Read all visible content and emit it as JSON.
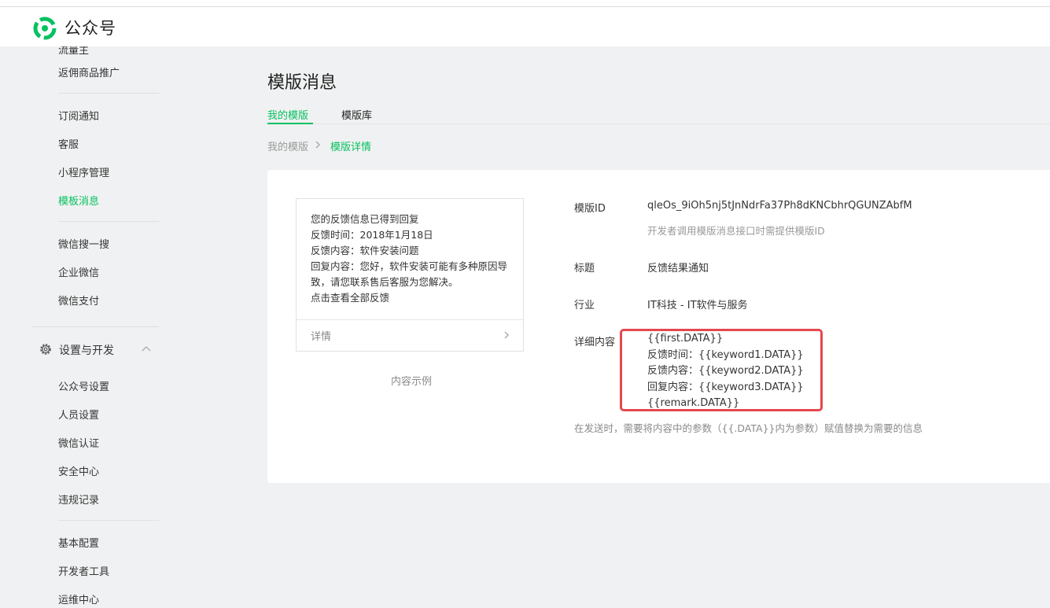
{
  "header": {
    "brand": "公众号",
    "brand_color": "#07c160"
  },
  "sidebar": {
    "cutoff_item": "流量主",
    "group1": [
      "返佣商品推广"
    ],
    "group2": [
      {
        "label": "订阅通知",
        "active": false
      },
      {
        "label": "客服",
        "active": false
      },
      {
        "label": "小程序管理",
        "active": false
      },
      {
        "label": "模板消息",
        "active": true
      }
    ],
    "group3": [
      "微信搜一搜",
      "企业微信",
      "微信支付"
    ],
    "section": {
      "label": "设置与开发",
      "icon": "gear-icon",
      "expanded": true
    },
    "group4": [
      "公众号设置",
      "人员设置",
      "微信认证",
      "安全中心",
      "违规记录"
    ],
    "group5": [
      "基本配置",
      "开发者工具",
      "运维中心"
    ]
  },
  "main": {
    "title": "模版消息",
    "tabs": [
      {
        "label": "我的模版",
        "active": true
      },
      {
        "label": "模版库",
        "active": false
      }
    ],
    "breadcrumb": [
      {
        "label": "我的模版",
        "active": false
      },
      {
        "label": "模版详情",
        "active": true
      }
    ],
    "preview": {
      "lines": [
        "您的反馈信息已得到回复",
        "反馈时间：2018年1月18日",
        "反馈内容：软件安装问题",
        "回复内容：您好，软件安装可能有多种原因导",
        "致，请您联系售后客服为您解决。",
        "点击查看全部反馈"
      ],
      "detail_label": "详情",
      "caption": "内容示例"
    },
    "details": {
      "template_id_label": "模版ID",
      "template_id": "qleOs_9iOh5nj5tJnNdrFa37Ph8dKNCbhrQGUNZAbfM",
      "template_id_hint": "开发者调用模版消息接口时需提供模版ID",
      "title_label": "标题",
      "title_value": "反馈结果通知",
      "industry_label": "行业",
      "industry_value": "IT科技 - IT软件与服务",
      "content_label": "详细内容",
      "content_lines": [
        "{{first.DATA}}",
        "反馈时间：{{keyword1.DATA}}",
        "反馈内容：{{keyword2.DATA}}",
        "回复内容：{{keyword3.DATA}}",
        "{{remark.DATA}}"
      ],
      "footnote": "在发送时，需要将内容中的参数（{{.DATA}}内为参数）赋值替换为需要的信息"
    },
    "highlight_color": "#e5484d"
  }
}
